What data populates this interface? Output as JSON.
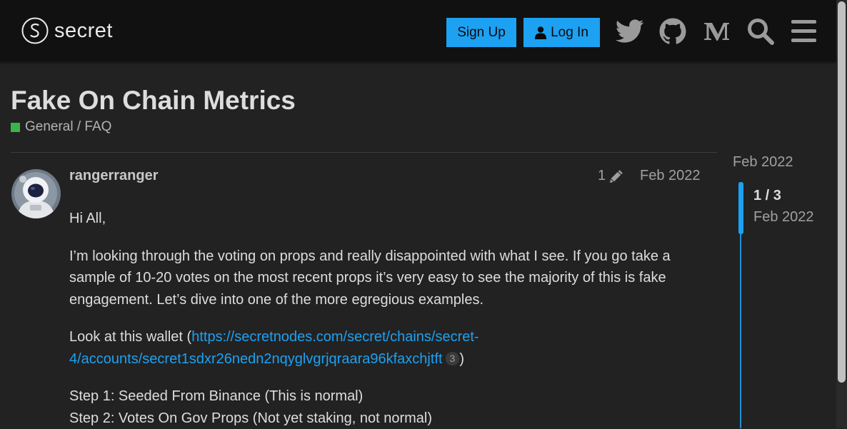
{
  "header": {
    "logo_text": "secret",
    "signup_label": "Sign Up",
    "login_label": "Log In",
    "icons": [
      "twitter-icon",
      "github-icon",
      "medium-icon",
      "search-icon",
      "menu-icon"
    ]
  },
  "topic": {
    "title": "Fake On Chain Metrics",
    "category": "General / FAQ",
    "category_color": "#3ab54a"
  },
  "post": {
    "username": "rangerranger",
    "edit_count": "1",
    "date": "Feb 2022",
    "paragraph1": "Hi All,",
    "paragraph2": "I’m looking through the voting on props and really disappointed with what I see. If you go take a sample of 10-20 votes on the most recent props it’s very easy to see the majority of this is fake engagement. Let’s dive into one of the more egregious examples.",
    "wallet_prefix": "Look at this wallet (",
    "wallet_link": "https://secretnodes.com/secret/chains/secret-4/accounts/secret1sdxr26nedn2nqyglvgrjqraara96kfaxchjtft",
    "wallet_clicks": "3",
    "wallet_suffix": ")",
    "step1": "Step 1: Seeded From Binance (This is normal)",
    "step2": "Step 2: Votes On Gov Props (Not yet staking, not normal)"
  },
  "timeline": {
    "start_date": "Feb 2022",
    "position": "1 / 3",
    "current_date": "Feb 2022"
  },
  "colors": {
    "accent": "#1da1f2",
    "header_bg": "#111111",
    "page_bg": "#222222"
  }
}
